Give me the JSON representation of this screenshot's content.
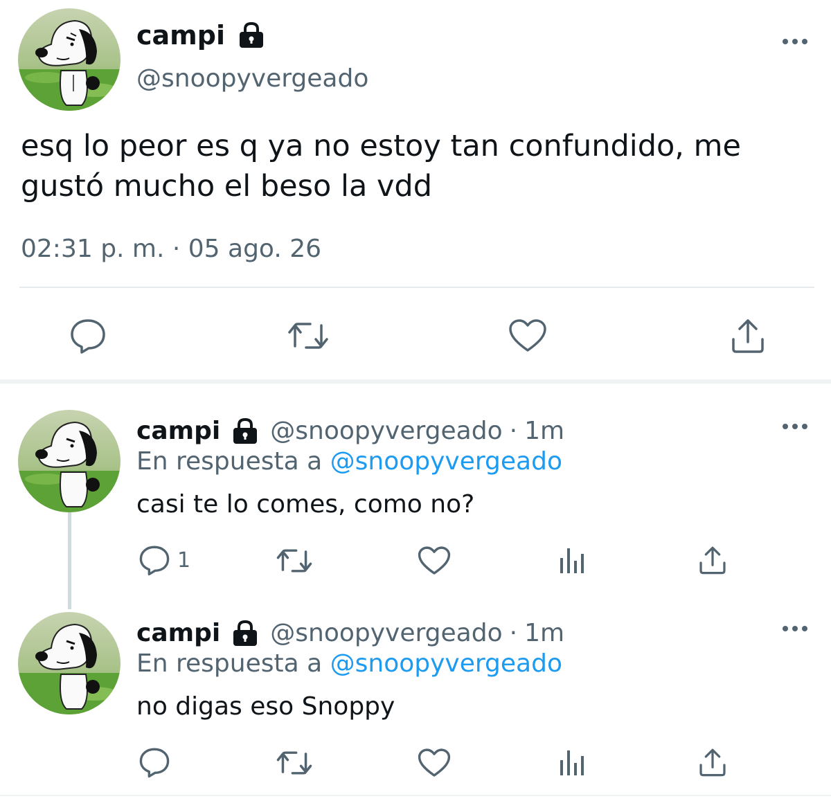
{
  "main_tweet": {
    "name": "campi",
    "handle": "@snoopyvergeado",
    "text": "esq lo peor es q ya no estoy tan confundido, me gustó mucho el beso la vdd",
    "timestamp": "02:31 p. m. · 05 ago. 26",
    "icons": [
      "lock-icon",
      "more-icon",
      "reply-icon",
      "retweet-icon",
      "like-icon",
      "share-icon"
    ]
  },
  "replies": [
    {
      "name": "campi",
      "handle": "@snoopyvergeado",
      "separator": "·",
      "time": "1m",
      "reply_prefix": "En respuesta a",
      "reply_to": "@snoopyvergeado",
      "text": "casi te lo comes, como no?",
      "reply_count": "1"
    },
    {
      "name": "campi",
      "handle": "@snoopyvergeado",
      "separator": "·",
      "time": "1m",
      "reply_prefix": "En respuesta a",
      "reply_to": "@snoopyvergeado",
      "text": "no digas eso Snoppy",
      "reply_count": ""
    }
  ],
  "colors": {
    "text_primary": "#0f1419",
    "text_secondary": "#536471",
    "mention": "#1d9bf0",
    "divider": "#eff3f4"
  }
}
